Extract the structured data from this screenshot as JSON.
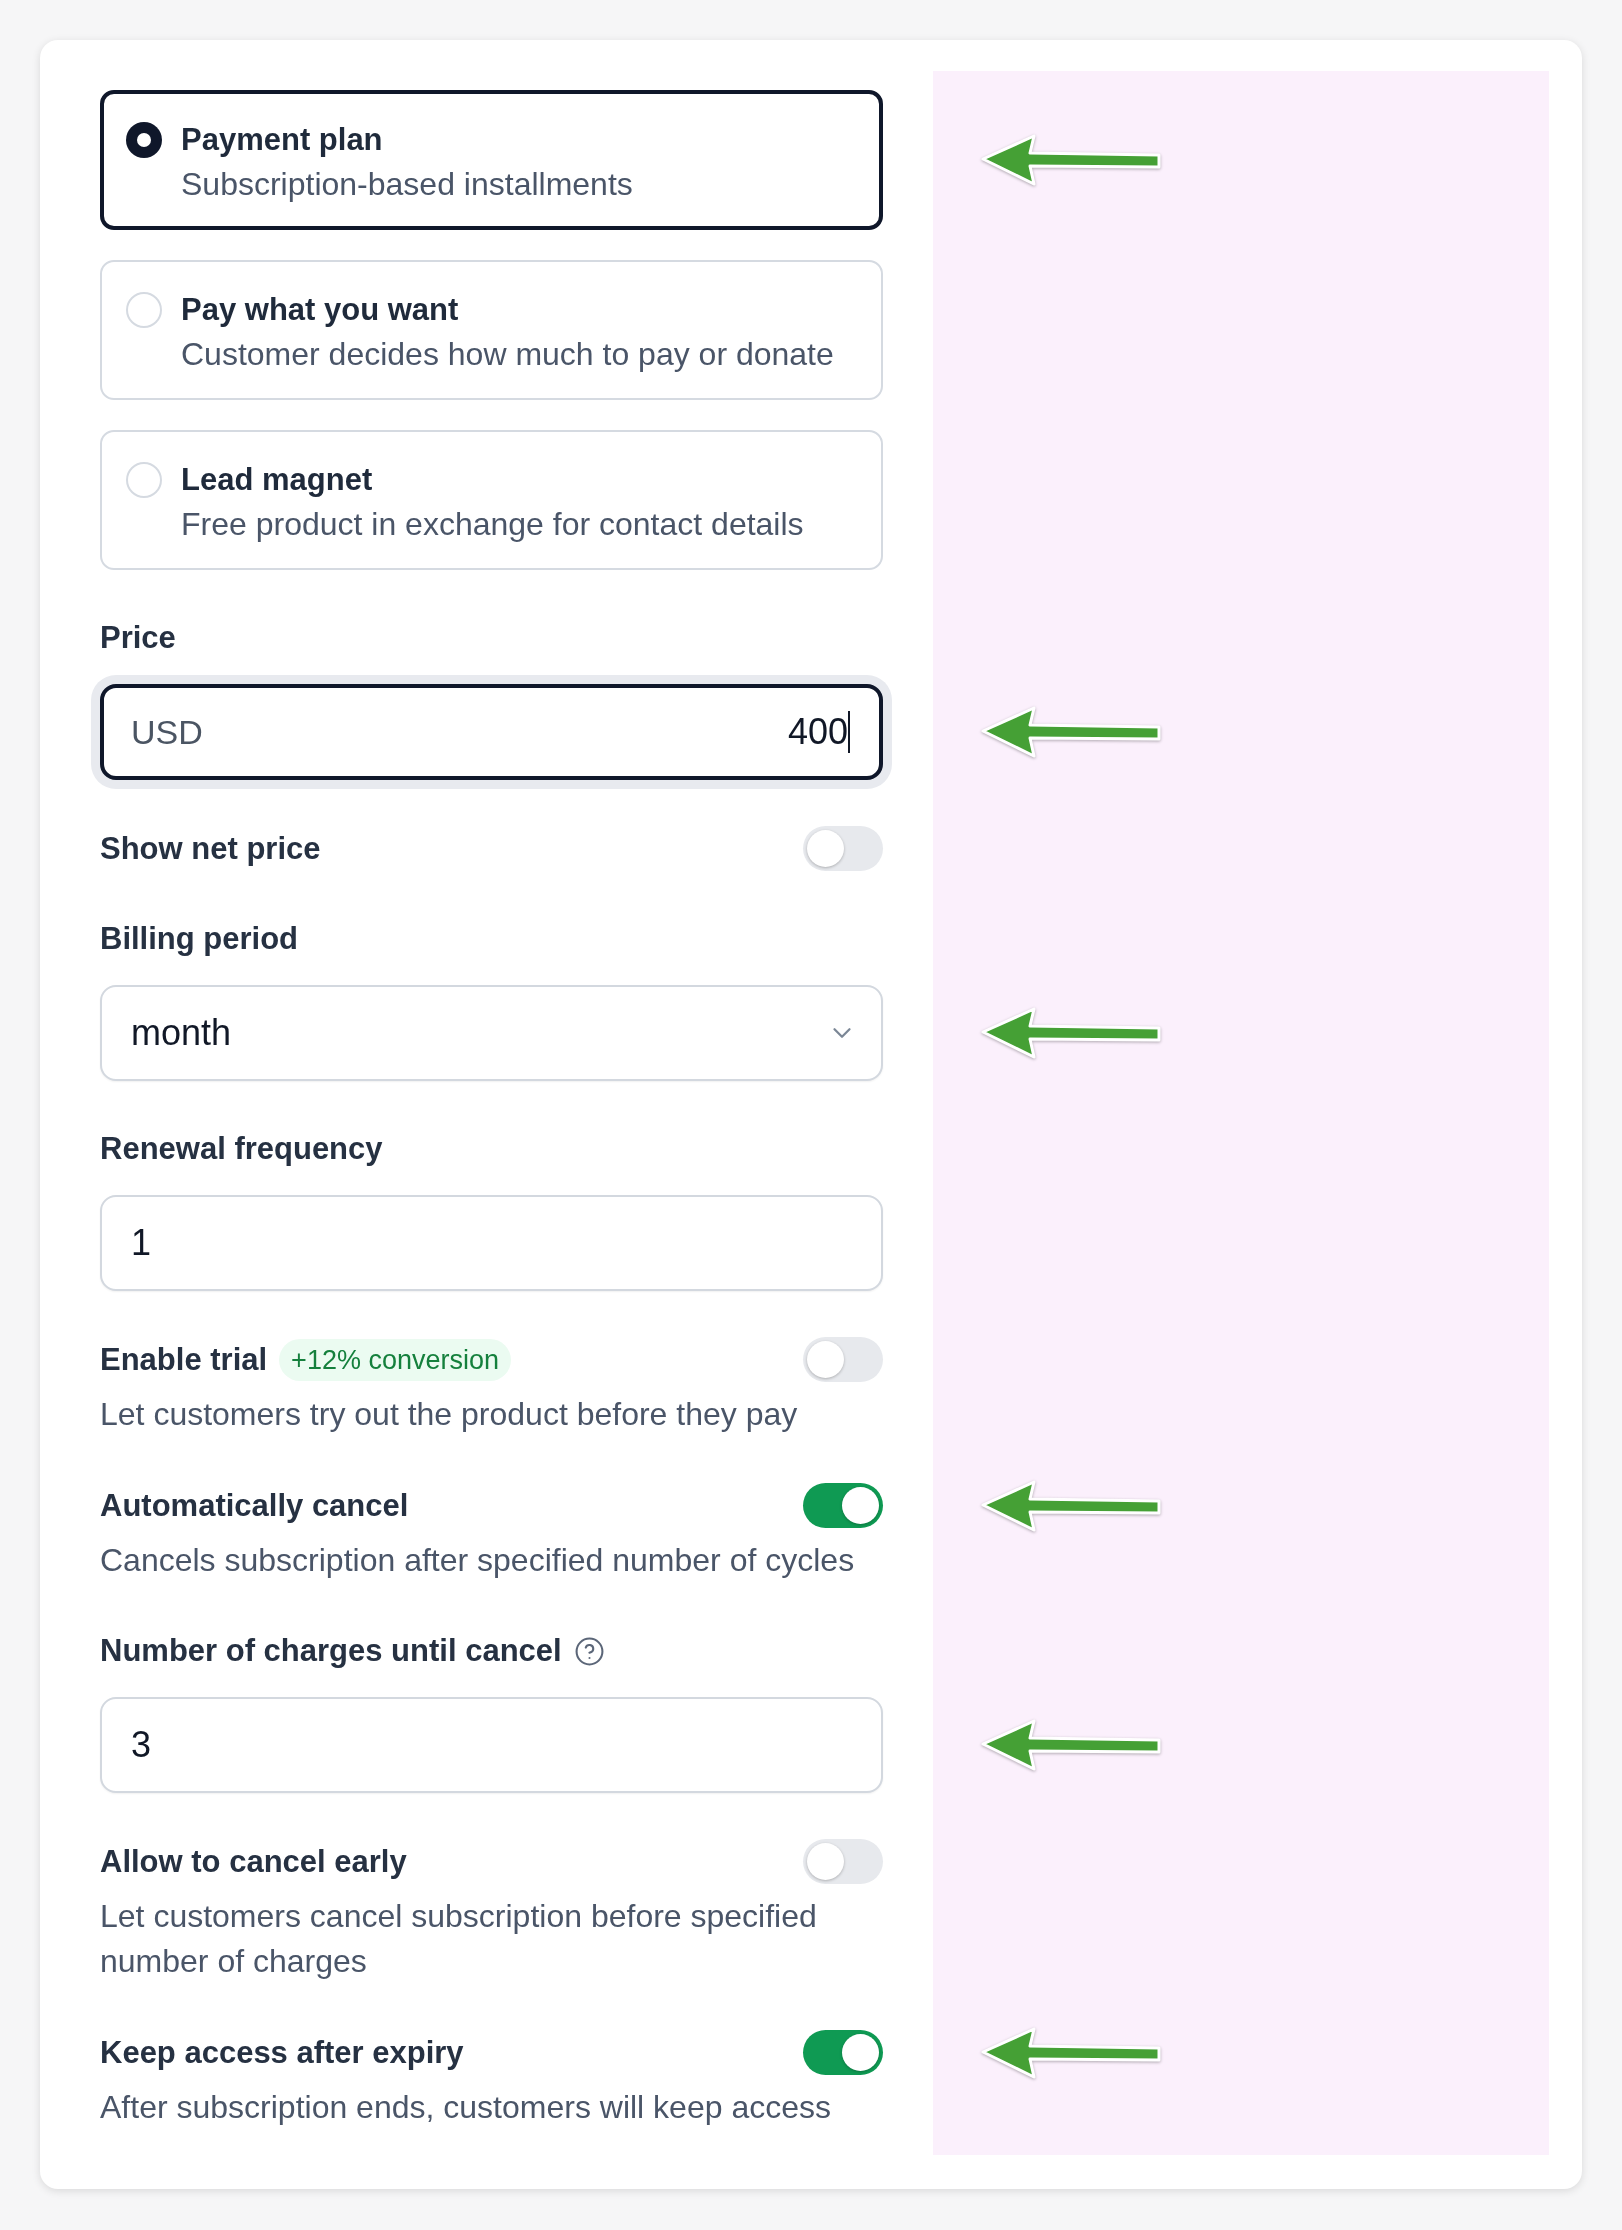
{
  "plan_options": [
    {
      "title": "Payment plan",
      "description": "Subscription-based installments",
      "selected": true,
      "arrow": true
    },
    {
      "title": "Pay what you want",
      "description": "Customer decides how much to pay or donate",
      "selected": false,
      "arrow": false
    },
    {
      "title": "Lead magnet",
      "description": "Free product in exchange for contact details",
      "selected": false,
      "arrow": false
    }
  ],
  "fields": [
    {
      "kind": "currency_input",
      "label": "Price",
      "help": false,
      "currency": "USD",
      "value": "400",
      "focused": true,
      "arrow": true
    },
    {
      "kind": "toggle",
      "label": "Show net price",
      "help": false,
      "on": false,
      "arrow": false
    },
    {
      "kind": "select",
      "label": "Billing period",
      "help": false,
      "value": "month",
      "focused": false,
      "arrow": true
    },
    {
      "kind": "input",
      "label": "Renewal frequency",
      "help": false,
      "value": "1",
      "focused": false,
      "arrow": false
    },
    {
      "kind": "toggle",
      "label": "Enable trial",
      "help": false,
      "badge": "+12% conversion",
      "description": "Let customers try out the product before they pay",
      "on": false,
      "arrow": false
    },
    {
      "kind": "toggle",
      "label": "Automatically cancel",
      "help": false,
      "description": "Cancels subscription after specified number of cycles",
      "on": true,
      "arrow": true
    },
    {
      "kind": "input",
      "label": "Number of charges until cancel",
      "help": true,
      "value": "3",
      "focused": false,
      "arrow": true
    },
    {
      "kind": "toggle",
      "label": "Allow to cancel early",
      "help": false,
      "description": "Let customers cancel subscription before specified number of charges",
      "on": false,
      "arrow": false
    },
    {
      "kind": "toggle",
      "label": "Keep access after expiry",
      "help": false,
      "description": "After subscription ends, customers will keep access",
      "on": true,
      "arrow": true
    }
  ]
}
